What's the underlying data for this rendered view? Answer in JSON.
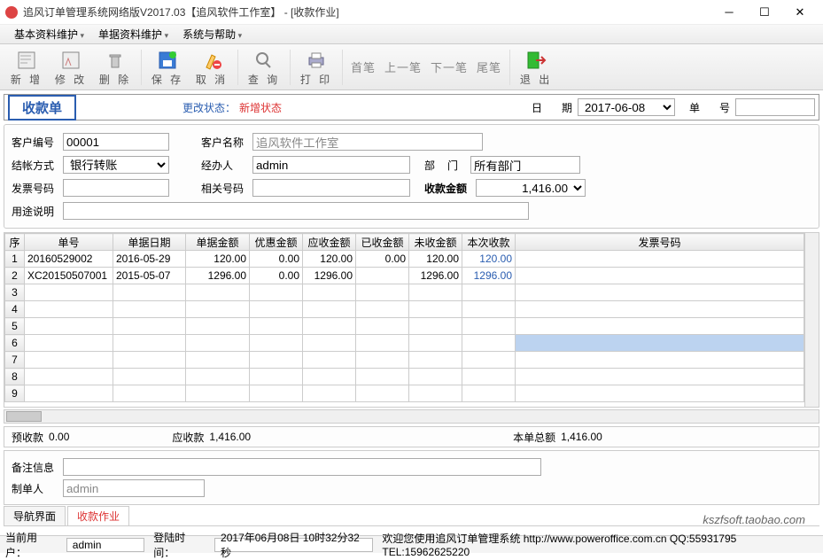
{
  "title": "追风订单管理系统网络版V2017.03【追风软件工作室】 - [收款作业]",
  "menu": [
    "基本资料维护",
    "单据资料维护",
    "系统与帮助"
  ],
  "toolbar": {
    "new": "新 增",
    "edit": "修 改",
    "del": "删 除",
    "save": "保 存",
    "cancel": "取 消",
    "query": "查 询",
    "print": "打 印",
    "first": "首笔",
    "prev": "上一笔",
    "next": "下一笔",
    "last": "尾笔",
    "exit": "退 出"
  },
  "header": {
    "doc_type": "收款单",
    "status_label": "更改状态：",
    "status_value": "新增状态",
    "date_label_1": "日",
    "date_label_2": "期",
    "date": "2017-06-08",
    "num_label_1": "单",
    "num_label_2": "号",
    "num": ""
  },
  "form": {
    "cust_no_lbl": "客户编号",
    "cust_no": "00001",
    "cust_name_lbl": "客户名称",
    "cust_name": "追风软件工作室",
    "settle_lbl": "结帐方式",
    "settle": "银行转账",
    "handler_lbl": "经办人",
    "handler": "admin",
    "dept_lbl1": "部",
    "dept_lbl2": "门",
    "dept": "所有部门",
    "invoice_lbl": "发票号码",
    "invoice": "",
    "rel_lbl": "相关号码",
    "rel": "",
    "amount_lbl": "收款金额",
    "amount": "1,416.00",
    "note_lbl": "用途说明",
    "note": ""
  },
  "grid": {
    "headers": [
      "序",
      "单号",
      "单据日期",
      "单据金额",
      "优惠金额",
      "应收金额",
      "已收金额",
      "未收金额",
      "本次收款",
      "发票号码"
    ],
    "rows": [
      {
        "n": "1",
        "no": "20160529002",
        "date": "2016-05-29",
        "amt": "120.00",
        "disc": "0.00",
        "due": "120.00",
        "paid": "0.00",
        "unpaid": "120.00",
        "this": "120.00",
        "inv": ""
      },
      {
        "n": "2",
        "no": "XC20150507001",
        "date": "2015-05-07",
        "amt": "1296.00",
        "disc": "0.00",
        "due": "1296.00",
        "paid": "",
        "unpaid": "1296.00",
        "this": "1296.00",
        "inv": ""
      }
    ]
  },
  "summary": {
    "pre_lbl": "预收款",
    "pre": "0.00",
    "due_lbl": "应收款",
    "due": "1,416.00",
    "total_lbl": "本单总额",
    "total": "1,416.00"
  },
  "lower": {
    "remark_lbl": "备注信息",
    "remark": "",
    "maker_lbl": "制单人",
    "maker": "admin"
  },
  "tabs": {
    "nav": "导航界面",
    "work": "收款作业"
  },
  "watermark": "kszfsoft.taobao.com",
  "status": {
    "user_lbl": "当前用户：",
    "user": "admin",
    "login_lbl": "登陆时间：",
    "login": "2017年06月08日 10时32分32秒",
    "welcome": "欢迎您使用追风订单管理系统 http://www.poweroffice.com.cn QQ:55931795 TEL:15962625220"
  }
}
